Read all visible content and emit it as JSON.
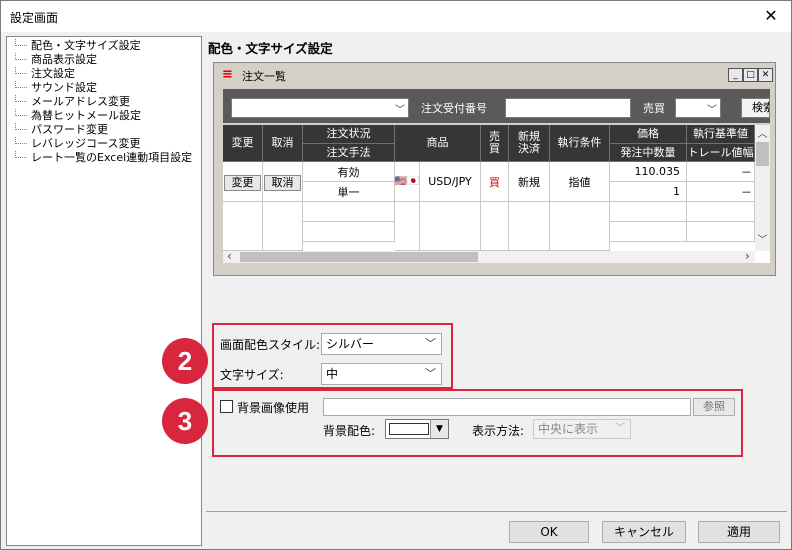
{
  "window": {
    "title": "設定画面",
    "close": "✕"
  },
  "tree": {
    "items": [
      "配色・文字サイズ設定",
      "商品表示設定",
      "注文設定",
      "サウンド設定",
      "メールアドレス変更",
      "為替ヒットメール設定",
      "パスワード変更",
      "レバレッジコース変更",
      "レート一覧のExcel連動項目設定"
    ]
  },
  "panel": {
    "title": "配色・文字サイズ設定"
  },
  "preview": {
    "title": "注文一覧",
    "min": "_",
    "max": "□",
    "close": "✕",
    "toolbar": {
      "order_no_label": "注文受付番号",
      "side_label": "売買",
      "search_label": "検索"
    },
    "headers": {
      "change": "変更",
      "cancel": "取消",
      "status": "注文状況",
      "method": "注文手法",
      "product": "商品",
      "side": "売買",
      "new_settle": "新規決済",
      "exec_cond": "執行条件",
      "price": "価格",
      "qty": "発注中数量",
      "exec_base": "執行基準値",
      "trail": "トレール値幅"
    },
    "row": {
      "change_btn": "変更",
      "cancel_btn": "取消",
      "status": "有効",
      "method": "単一",
      "flag": "🇺🇸🇯🇵",
      "product": "USD/JPY",
      "side": "買",
      "new_settle": "新規",
      "exec_cond": "指値",
      "price": "110.035",
      "qty": "1",
      "exec_base": "－",
      "trail": "－"
    }
  },
  "settings": {
    "badge_2": "2",
    "badge_3": "3",
    "color_style_label": "画面配色スタイル:",
    "color_style_value": "シルバー",
    "font_size_label": "文字サイズ:",
    "font_size_value": "中",
    "bg_image_label": "背景画像使用",
    "browse_label": "参照",
    "bg_color_label": "背景配色:",
    "display_method_label": "表示方法:",
    "display_method_value": "中央に表示"
  },
  "buttons": {
    "ok": "OK",
    "cancel": "キャンセル",
    "apply": "適用"
  }
}
